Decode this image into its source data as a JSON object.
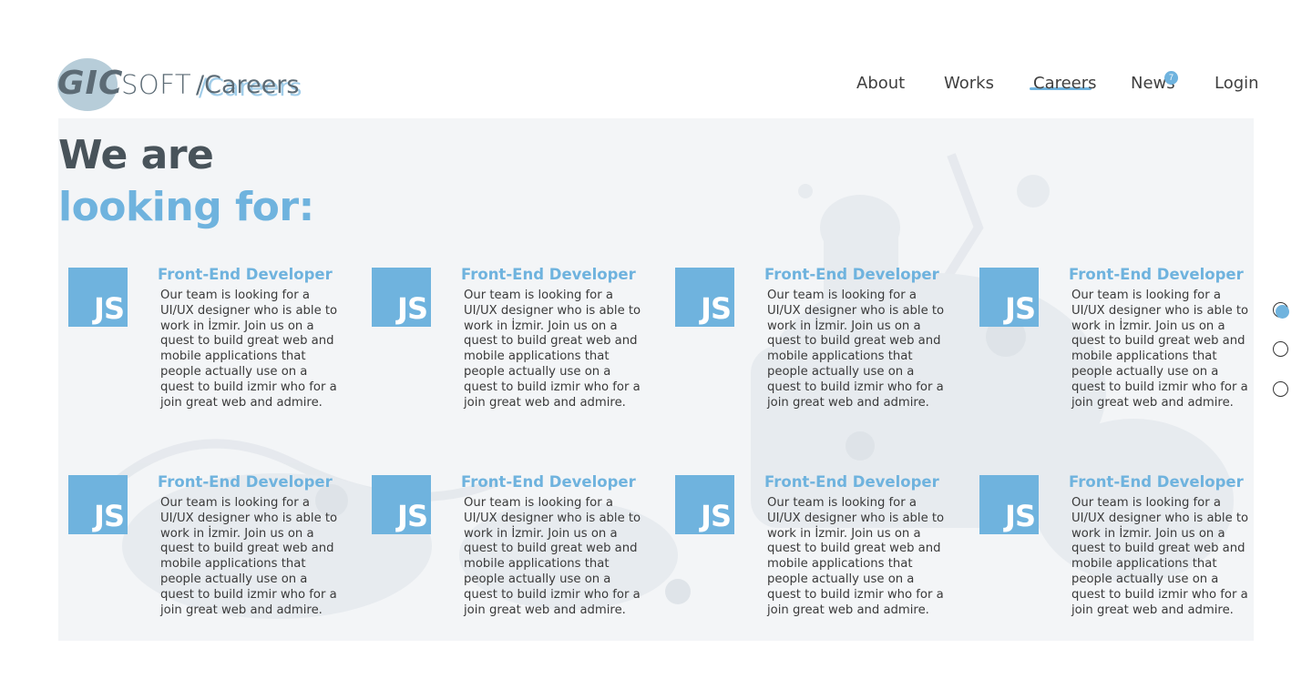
{
  "header": {
    "logo": {
      "brand_bold": "GIC",
      "brand_light": "SOFT",
      "section": "/Careers"
    },
    "nav": {
      "items": [
        {
          "label": "About"
        },
        {
          "label": "Works"
        },
        {
          "label": "Careers",
          "active": true
        },
        {
          "label": "News",
          "badge": "7"
        },
        {
          "label": "Login"
        }
      ]
    }
  },
  "heading": {
    "line1": "We are",
    "line2": "looking for:"
  },
  "jobs": [
    {
      "icon": "JS",
      "title": "Front-End Developer",
      "description": "Our team is looking for a UI/UX designer who is able to work in İzmir. Join us on a quest to build great web and mobile applications that people actually use on a quest to build izmir who for a join great web  and admire."
    },
    {
      "icon": "JS",
      "title": "Front-End Developer",
      "description": "Our team is looking for a UI/UX designer who is able to work in İzmir. Join us on a quest to build great web and mobile applications that people actually use on a quest to build izmir who for a join great web  and admire."
    },
    {
      "icon": "JS",
      "title": "Front-End Developer",
      "description": "Our team is looking for a UI/UX designer who is able to work in İzmir. Join us on a quest to build great web and mobile applications that people actually use on a quest to build izmir who for a join great web  and admire."
    },
    {
      "icon": "JS",
      "title": "Front-End Developer",
      "description": "Our team is looking for a UI/UX designer who is able to work in İzmir. Join us on a quest to build great web and mobile applications that people actually use on a quest to build izmir who for a join great web  and admire."
    },
    {
      "icon": "JS",
      "title": "Front-End Developer",
      "description": "Our team is looking for a UI/UX designer who is able to work in İzmir. Join us on a quest to build great web and mobile applications that people actually use on a quest to build izmir who for a join great web  and admire."
    },
    {
      "icon": "JS",
      "title": "Front-End Developer",
      "description": "Our team is looking for a UI/UX designer who is able to work in İzmir. Join us on a quest to build great web and mobile applications that people actually use on a quest to build izmir who for a join great web  and admire."
    },
    {
      "icon": "JS",
      "title": "Front-End Developer",
      "description": "Our team is looking for a UI/UX designer who is able to work in İzmir. Join us on a quest to build great web and mobile applications that people actually use on a quest to build izmir who for a join great web  and admire."
    },
    {
      "icon": "JS",
      "title": "Front-End Developer",
      "description": "Our team is looking for a UI/UX designer who is able to work in İzmir. Join us on a quest to build great web and mobile applications that people actually use on a quest to build izmir who for a join great web  and admire."
    }
  ],
  "pager": {
    "count": 3,
    "active_index": 0
  },
  "colors": {
    "accent": "#6fb3de",
    "heading_dark": "#48535a",
    "logo_gray": "#5c6b75",
    "logo_oval": "#b7cdd9",
    "text": "#3a3a3a"
  }
}
